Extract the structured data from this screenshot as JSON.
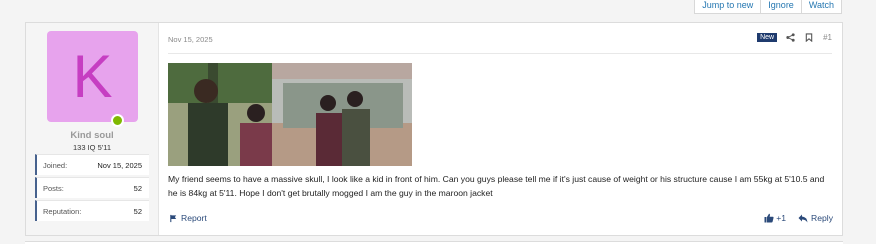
{
  "topbar": {
    "buttons": [
      "Jump to new",
      "Ignore",
      "Watch"
    ]
  },
  "user": {
    "avatar_letter": "K",
    "avatar_bg": "#e7a3ed",
    "avatar_fg": "#c63ec2",
    "online_color": "#7fb800",
    "username": "Kind soul",
    "usertitle": "133 IQ 5'11",
    "stats": [
      {
        "label": "Joined:",
        "value": "Nov 15, 2025"
      },
      {
        "label": "Posts:",
        "value": "52"
      },
      {
        "label": "Reputation:",
        "value": "52"
      }
    ]
  },
  "post": {
    "date": "Nov 15, 2025",
    "badge": "New",
    "number": "#1",
    "icons": [
      "share-icon",
      "bookmark-icon"
    ],
    "text": "My friend seems to have a massive skull, I look like a kid in front of him. Can you guys please tell me if it's just cause of weight or his structure cause I am 55kg at 5'10.5 and he is 84kg at 5'11. Hope I don't get brutally mogged I am the guy in the maroon jacket",
    "report_label": "Report",
    "likes": "+1",
    "reply_label": "Reply"
  }
}
